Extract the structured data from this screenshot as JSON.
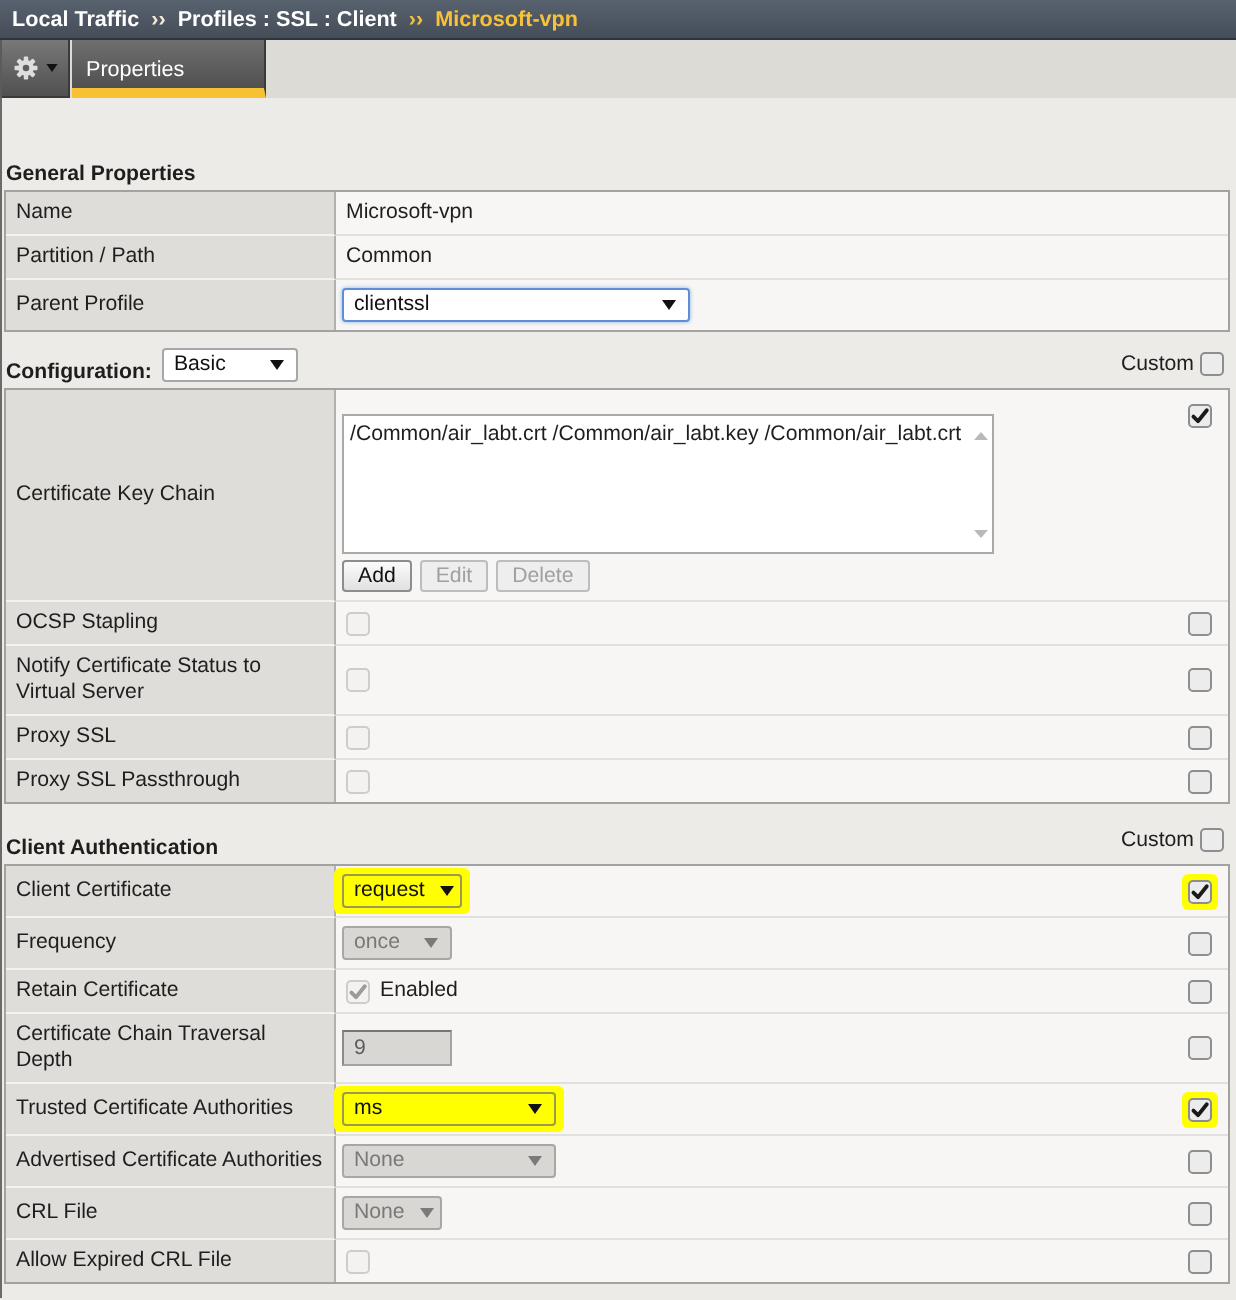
{
  "breadcrumb": [
    {
      "label": "Local Traffic",
      "current": false
    },
    {
      "separator": "››",
      "label": "Profiles : SSL : Client",
      "current": false
    },
    {
      "separator": "››",
      "label": "Microsoft-vpn",
      "current": true
    }
  ],
  "tabs": [
    {
      "label": "Properties",
      "selected": true
    }
  ],
  "general": {
    "title": "General Properties",
    "rows": [
      {
        "label": "Name",
        "kind": "text",
        "value": "Microsoft-vpn"
      },
      {
        "label": "Partition / Path",
        "kind": "text",
        "value": "Common"
      },
      {
        "label": "Parent Profile",
        "kind": "select",
        "value": "clientssl",
        "focused": true
      }
    ]
  },
  "configuration": {
    "title": "Configuration:",
    "mode": {
      "value": "Basic"
    },
    "custom": {
      "label": "Custom",
      "checked": false
    },
    "rows": [
      {
        "label": "Certificate Key Chain",
        "kind": "keychain",
        "entries": [
          {
            "text": "/Common/air_labt.crt /Common/air_labt.key /Common/air_labt.crt",
            "selected": false
          }
        ],
        "buttons": [
          {
            "label": "Add",
            "disabled": false
          },
          {
            "label": "Edit",
            "disabled": true
          },
          {
            "label": "Delete",
            "disabled": true
          }
        ],
        "custom_checked": true
      },
      {
        "label": "OCSP Stapling",
        "kind": "checkbox",
        "checked": false,
        "disabled": true,
        "custom_checked": false
      },
      {
        "label": "Notify Certificate Status to Virtual Server",
        "kind": "checkbox",
        "checked": false,
        "disabled": true,
        "custom_checked": false
      },
      {
        "label": "Proxy SSL",
        "kind": "checkbox",
        "checked": false,
        "disabled": true,
        "custom_checked": false
      },
      {
        "label": "Proxy SSL Passthrough",
        "kind": "checkbox",
        "checked": false,
        "disabled": true,
        "custom_checked": false
      }
    ]
  },
  "client_authentication": {
    "title": "Client Authentication",
    "custom": {
      "label": "Custom",
      "checked": false
    },
    "rows": [
      {
        "label": "Client Certificate",
        "kind": "select",
        "value": "request",
        "disabled": false,
        "highlighted": true,
        "custom_checked": true
      },
      {
        "label": "Frequency",
        "kind": "select",
        "value": "once",
        "disabled": true,
        "highlighted": false,
        "custom_checked": false
      },
      {
        "label": "Retain Certificate",
        "kind": "checkbox",
        "checked": true,
        "disabled": true,
        "text": "Enabled",
        "highlighted": false,
        "custom_checked": false
      },
      {
        "label": "Certificate Chain Traversal Depth",
        "kind": "input",
        "value": "9",
        "disabled": true,
        "highlighted": false,
        "custom_checked": false
      },
      {
        "label": "Trusted Certificate Authorities",
        "kind": "select",
        "value": "ms",
        "disabled": false,
        "highlighted": true,
        "custom_checked": true
      },
      {
        "label": "Advertised Certificate Authorities",
        "kind": "select",
        "value": "None",
        "disabled": true,
        "highlighted": false,
        "custom_checked": false
      },
      {
        "label": "CRL File",
        "kind": "select",
        "value": "None",
        "disabled": true,
        "highlighted": false,
        "custom_checked": false
      },
      {
        "label": "Allow Expired CRL File",
        "kind": "checkbox",
        "checked": false,
        "disabled": true,
        "highlighted": false,
        "custom_checked": false
      }
    ]
  }
}
